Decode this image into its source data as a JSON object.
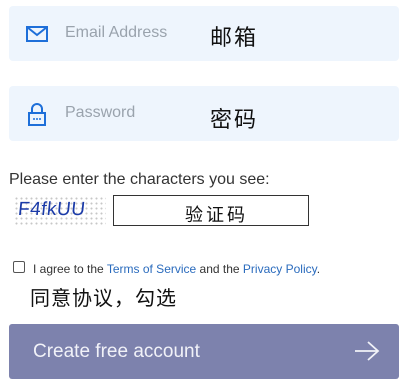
{
  "email": {
    "placeholder": "Email Address",
    "annotation": "邮箱",
    "icon": "envelope-icon"
  },
  "password": {
    "placeholder": "Password",
    "annotation": "密码",
    "icon": "lock-icon"
  },
  "captcha": {
    "prompt": "Please enter the characters you see:",
    "image_text": "F4fkUU",
    "annotation": "验证码"
  },
  "agreement": {
    "prefix": "I agree to the ",
    "terms_link": "Terms of Service",
    "middle": " and the ",
    "privacy_link": "Privacy Policy",
    "suffix": ".",
    "annotation": "同意协议，勾选"
  },
  "submit": {
    "label": "Create free account",
    "icon": "arrow-right-icon"
  },
  "colors": {
    "field_background": "#eef5fd",
    "icon_blue": "#1e6fd9",
    "button_background": "#7d82ad",
    "link": "#2a6bbd"
  }
}
